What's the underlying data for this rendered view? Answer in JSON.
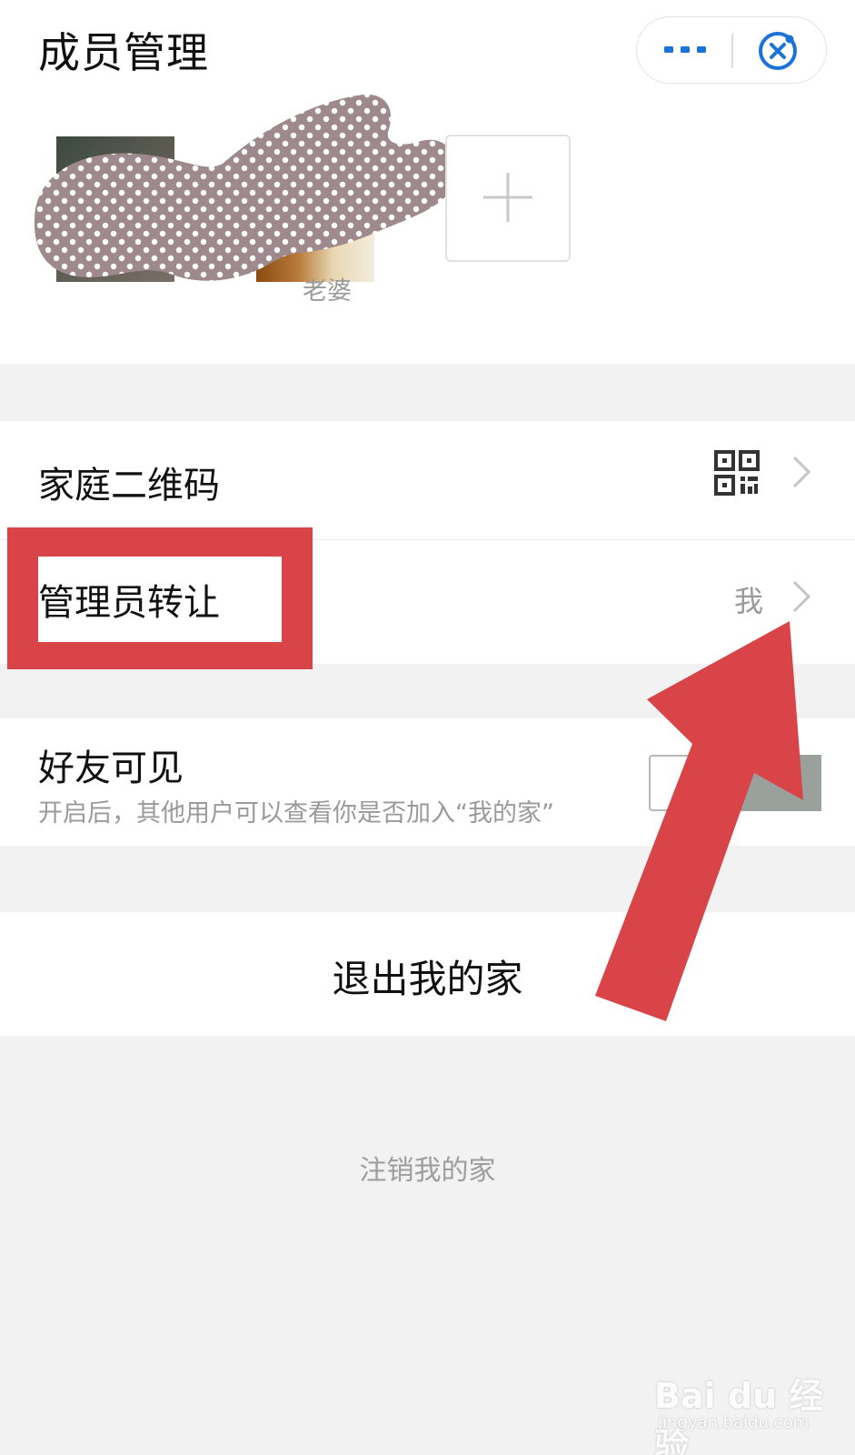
{
  "header": {
    "title": "成员管理"
  },
  "members": [
    {
      "name": ""
    },
    {
      "name": "老婆"
    }
  ],
  "rows": {
    "qrcode": {
      "label": "家庭二维码"
    },
    "transfer": {
      "label": "管理员转让",
      "value": "我"
    },
    "visible": {
      "label": "好友可见",
      "subtitle": "开启后，其他用户可以查看你是否加入“我的家”",
      "enabled": false
    }
  },
  "actions": {
    "exit_label": "退出我的家",
    "deregister_label": "注销我的家"
  },
  "annotation": {
    "color": "#d94448"
  },
  "watermark": {
    "logo": "Bai du 经验",
    "domain": "jingyan.baidu.com"
  }
}
